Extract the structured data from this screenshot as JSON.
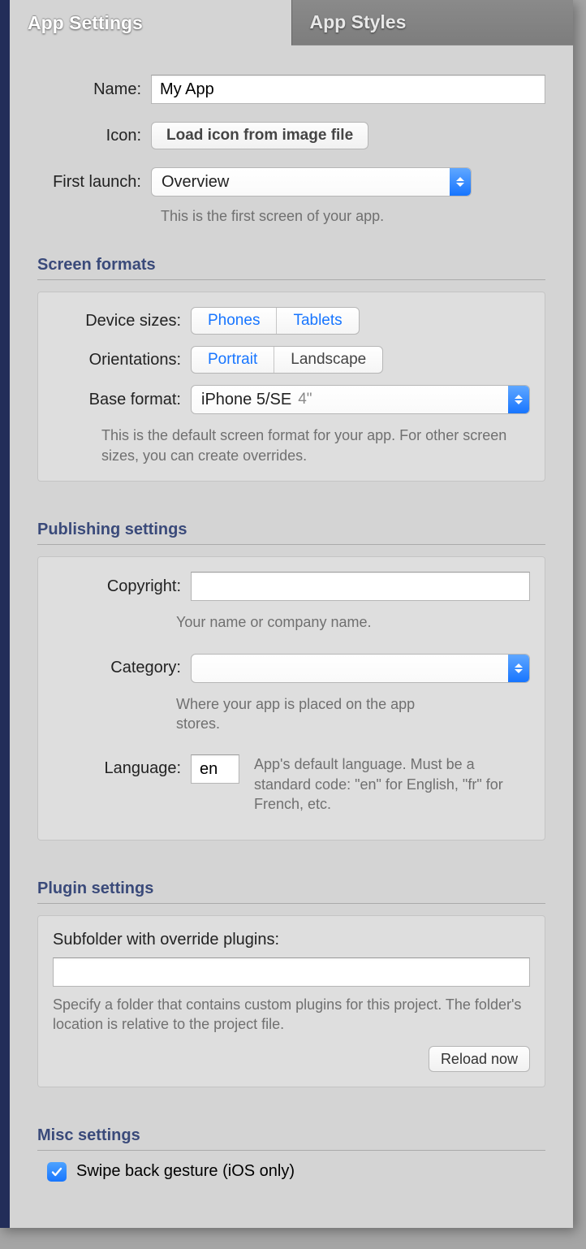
{
  "tabs": {
    "settings": "App Settings",
    "styles": "App Styles"
  },
  "name": {
    "label": "Name:",
    "value": "My App"
  },
  "icon": {
    "label": "Icon:",
    "button": "Load icon from image file"
  },
  "first_launch": {
    "label": "First launch:",
    "value": "Overview",
    "hint": "This is the first screen of your app."
  },
  "screen_formats": {
    "title": "Screen formats",
    "device_sizes_label": "Device sizes:",
    "seg_phones": "Phones",
    "seg_tablets": "Tablets",
    "orientations_label": "Orientations:",
    "seg_portrait": "Portrait",
    "seg_landscape": "Landscape",
    "base_format_label": "Base format:",
    "base_format_primary": "iPhone 5/SE",
    "base_format_secondary": "4\"",
    "hint": "This is the default screen format for your app. For other screen sizes, you can create overrides."
  },
  "publishing": {
    "title": "Publishing settings",
    "copyright_label": "Copyright:",
    "copyright_value": "",
    "copyright_hint": "Your name or company name.",
    "category_label": "Category:",
    "category_value": "",
    "category_hint": "Where your app is placed on the app stores.",
    "language_label": "Language:",
    "language_value": "en",
    "language_hint": "App's default language. Must be a standard code: \"en\" for English, \"fr\" for French, etc."
  },
  "plugin": {
    "title": "Plugin settings",
    "subfolder_label": "Subfolder with override plugins:",
    "subfolder_value": "",
    "hint": "Specify a folder that contains custom plugins for this project. The folder's location is relative to the project file.",
    "reload_button": "Reload now"
  },
  "misc": {
    "title": "Misc settings",
    "swipe_back_label": "Swipe back gesture (iOS only)",
    "swipe_back_checked": true
  }
}
